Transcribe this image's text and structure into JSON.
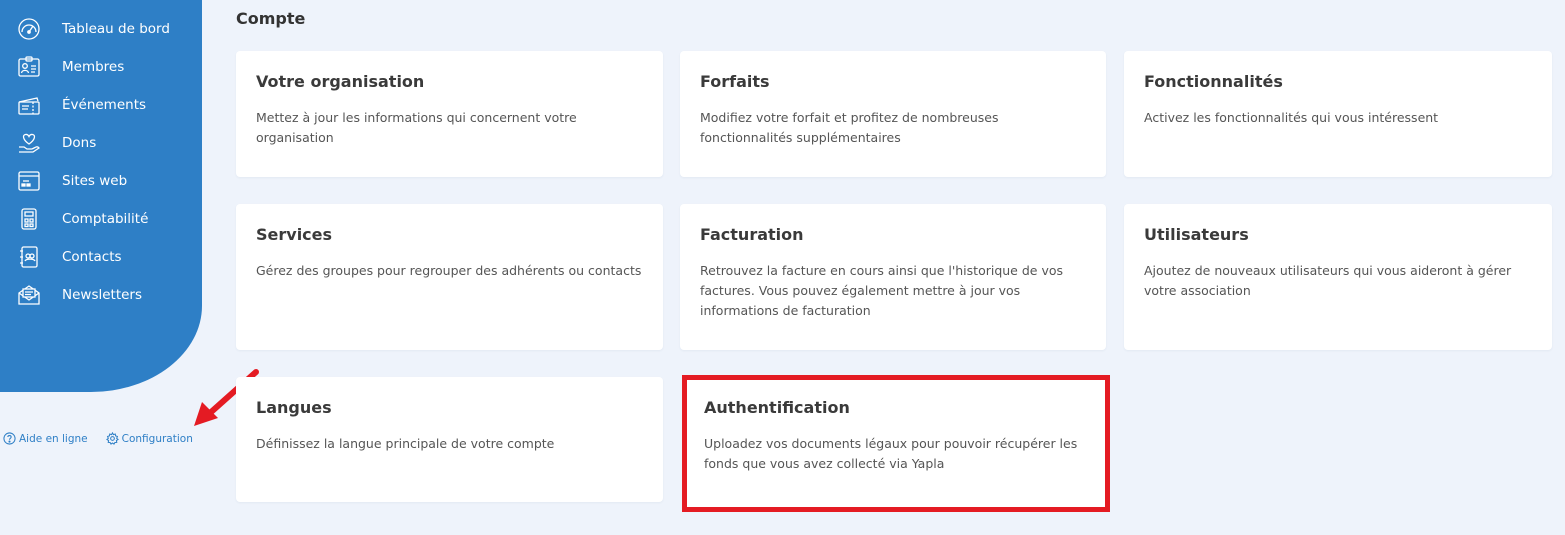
{
  "sidebar": {
    "items": [
      {
        "label": "Tableau de bord",
        "icon": "dashboard-icon"
      },
      {
        "label": "Membres",
        "icon": "members-icon"
      },
      {
        "label": "Événements",
        "icon": "events-icon"
      },
      {
        "label": "Dons",
        "icon": "donations-icon"
      },
      {
        "label": "Sites web",
        "icon": "website-icon"
      },
      {
        "label": "Comptabilité",
        "icon": "calculator-icon"
      },
      {
        "label": "Contacts",
        "icon": "contacts-icon"
      },
      {
        "label": "Newsletters",
        "icon": "newsletter-icon"
      }
    ],
    "footer": {
      "help_label": "Aide en ligne",
      "config_label": "Configuration"
    }
  },
  "main": {
    "section_title": "Compte",
    "cards": [
      {
        "title": "Votre organisation",
        "desc": "Mettez à jour les informations qui concernent votre organisation"
      },
      {
        "title": "Forfaits",
        "desc": "Modifiez votre forfait et profitez de nombreuses fonctionnalités supplémentaires"
      },
      {
        "title": "Fonctionnalités",
        "desc": "Activez les fonctionnalités qui vous intéressent"
      },
      {
        "title": "Services",
        "desc": "Gérez des groupes pour regrouper des adhérents ou contacts"
      },
      {
        "title": "Facturation",
        "desc": "Retrouvez la facture en cours ainsi que l'historique de vos factures. Vous pouvez également mettre à jour vos informations de facturation"
      },
      {
        "title": "Utilisateurs",
        "desc": "Ajoutez de nouveaux utilisateurs qui vous aideront à gérer votre association"
      },
      {
        "title": "Langues",
        "desc": "Définissez la langue principale de votre compte"
      },
      {
        "title": "Authentification",
        "desc": "Uploadez vos documents légaux pour pouvoir récupérer les fonds que vous avez collecté via Yapla"
      }
    ]
  },
  "colors": {
    "sidebar_blue": "#2e7fc6",
    "page_bg": "#eef3fb",
    "highlight_red": "#e41b23"
  }
}
